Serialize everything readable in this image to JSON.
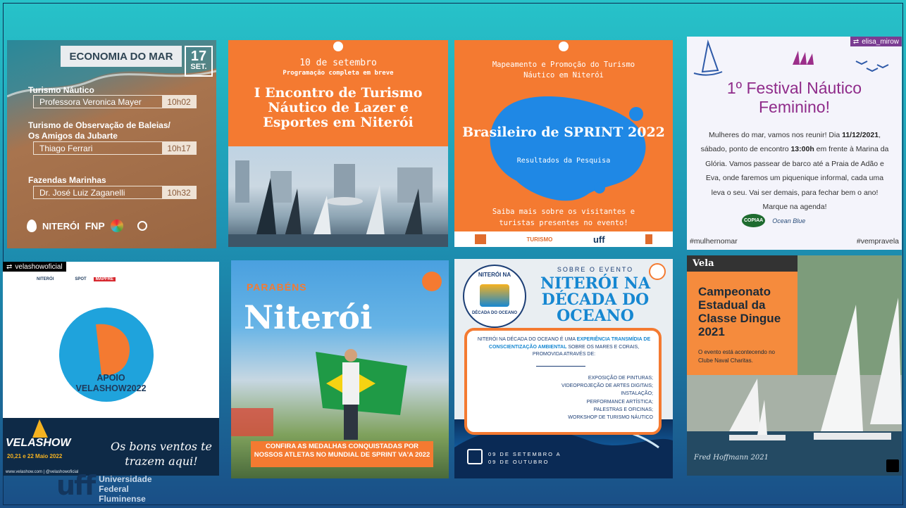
{
  "tiles": {
    "economia": {
      "header": "ECONOMIA DO MAR",
      "date_day": "17",
      "date_month": "SET.",
      "sections": [
        {
          "title": "Turismo Náutico",
          "speaker": "Professora Veronica Mayer",
          "time": "10h02"
        },
        {
          "title": "Turismo de Observação de Baleias/\nOs Amigos da Jubarte",
          "speaker": "Thiago Ferrari",
          "time": "10h17"
        },
        {
          "title": "Fazendas Marinhas",
          "speaker": "Dr. José Luiz Zaganelli",
          "time": "10h32"
        }
      ],
      "logo_niteroi": "NITERÓI",
      "logo_fnp": "FNP"
    },
    "encontro": {
      "date": "10 de setembro",
      "sub": "Programação completa em breve",
      "title": "I Encontro de Turismo Náutico de Lazer e Esportes em Niterói"
    },
    "sprint": {
      "heading": "Mapeamento e Promoção do Turismo Náutico em Niterói",
      "title": "Brasileiro de SPRINT 2022",
      "sub": "Resultados da Pesquisa",
      "footer": "Saiba mais sobre os visitantes e turistas presentes no evento!",
      "strip_label": "TURISMO",
      "strip_logo": "uff"
    },
    "festival": {
      "account": "elisa_mirow",
      "title": "1º Festival Náutico Feminino!",
      "body_1": "Mulheres do mar, vamos nos reunir! Dia ",
      "body_date": "11/12/2021",
      "body_2": ", sábado, ponto de encontro ",
      "body_time": "13:00h",
      "body_3": " em frente à Marina da Glória. Vamos passear de barco até a Praia de Adão e Eva, onde faremos um piquenique informal, cada uma leva o seu. Vai ser demais, para fechar bem o ano! Marque na agenda!",
      "hashtag_left": "#mulhernomar",
      "hashtag_right": "#vempravela",
      "sponsor_1": "COPIAA",
      "sponsor_2": "Ocean Blue"
    },
    "velashow": {
      "account": "velashowoficial",
      "apoio_1": "APOIO",
      "apoio_2": "VELASHOW2022",
      "brand": "VELASHOW",
      "brand_dates": "20,21 e 22 Maio 2022",
      "slogan": "Os bons ventos te trazem aqui!",
      "url": "www.velashow.com | @velashowoficial",
      "sponsor_1": "NITERÓI",
      "sponsor_2": "SPOT",
      "sponsor_3": "MAPFRE"
    },
    "parabens": {
      "label": "PARABÉNS",
      "city": "Niterói",
      "caption": "CONFIRA AS MEDALHAS CONQUISTADAS POR NOSSOS ATLETAS NO MUNDIAL DE SPRINT VA'A 2022"
    },
    "decada": {
      "seal_top": "NITERÓI NA",
      "seal_bottom": "DÉCADA DO OCEANO",
      "kicker": "SOBRE O EVENTO",
      "title": "NITERÓI NA DÉCADA DO OCEANO",
      "intro_1": "NITERÓI NA DÉCADA DO OCEANO É UMA ",
      "intro_hl_1": "EXPERIÊNCIA TRANSMÍDIA DE CONSCIENTIZAÇÃO AMBIENTAL",
      "intro_2": " SOBRE OS MARES E CORAIS, PROMOVIDA ATRAVÉS DE:",
      "items": [
        "EXPOSIÇÃO DE PINTURAS;",
        "VIDEOPROJEÇÃO DE ARTES DIGITAIS;",
        "INSTALAÇÃO;",
        "PERFORMANCE ARTÍSTICA;",
        "PALESTRAS E OFICINAS;",
        "WORKSHOP DE TURISMO NÁUTICO"
      ],
      "date_1": "09 DE SETEMBRO A",
      "date_2": "09 DE OUTUBRO"
    },
    "vela": {
      "label": "Vela",
      "title": "Campeonato Estadual da Classe Dingue 2021",
      "sub": "O evento está acontecendo no Clube Naval Charitas.",
      "signature": "Fred Hoffmann 2021"
    }
  },
  "footer": {
    "mark": "uff",
    "name_1": "Universidade",
    "name_2": "Federal",
    "name_3": "Fluminense"
  },
  "colors": {
    "accent_orange": "#f47a31",
    "festival_purple": "#8f2b8a",
    "ocean_blue": "#1687d1",
    "navy": "#13365e"
  }
}
